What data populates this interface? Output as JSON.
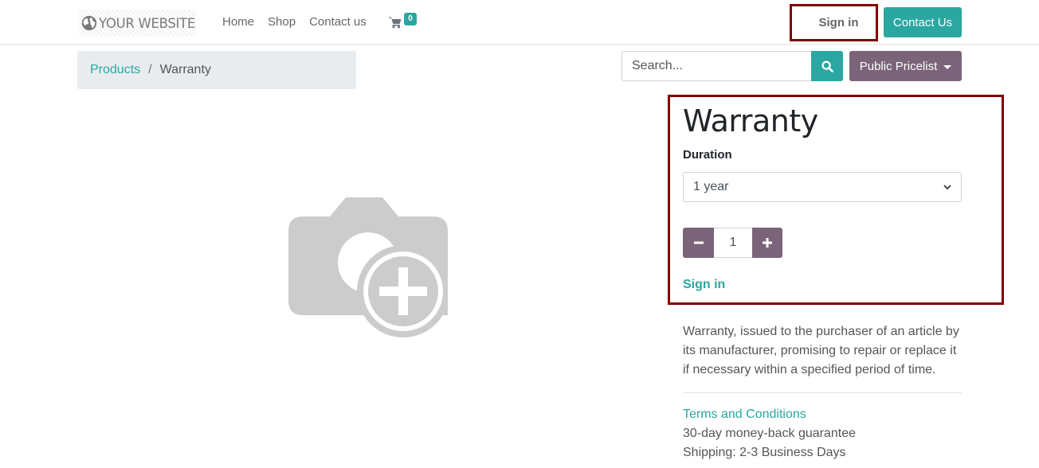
{
  "header": {
    "logo_text": "YOUR WEBSITE",
    "nav": [
      "Home",
      "Shop",
      "Contact us"
    ],
    "cart_count": "0",
    "sign_in": "Sign in",
    "contact_button": "Contact Us"
  },
  "breadcrumb": {
    "link": "Products",
    "separator": "/",
    "current": "Warranty"
  },
  "search": {
    "placeholder": "Search...",
    "pricelist": "Public Pricelist"
  },
  "product": {
    "title": "Warranty",
    "attribute_label": "Duration",
    "duration_selected": "1 year",
    "quantity": "1",
    "sign_in_link": "Sign in",
    "description": "Warranty, issued to the purchaser of an article by its manufacturer, promising to repair or replace it if necessary within a specified period of time.",
    "terms_link": "Terms and Conditions",
    "guarantee": "30-day money-back guarantee",
    "shipping": "Shipping: 2-3 Business Days"
  },
  "colors": {
    "primary": "#2aa7a0",
    "secondary": "#7b6479",
    "highlight": "#7f0000"
  },
  "icons": {
    "logo": "globe-icon",
    "cart": "shopping-cart-icon",
    "search": "search-icon",
    "image_placeholder": "camera-plus-icon",
    "minus": "minus-icon",
    "plus": "plus-icon"
  }
}
